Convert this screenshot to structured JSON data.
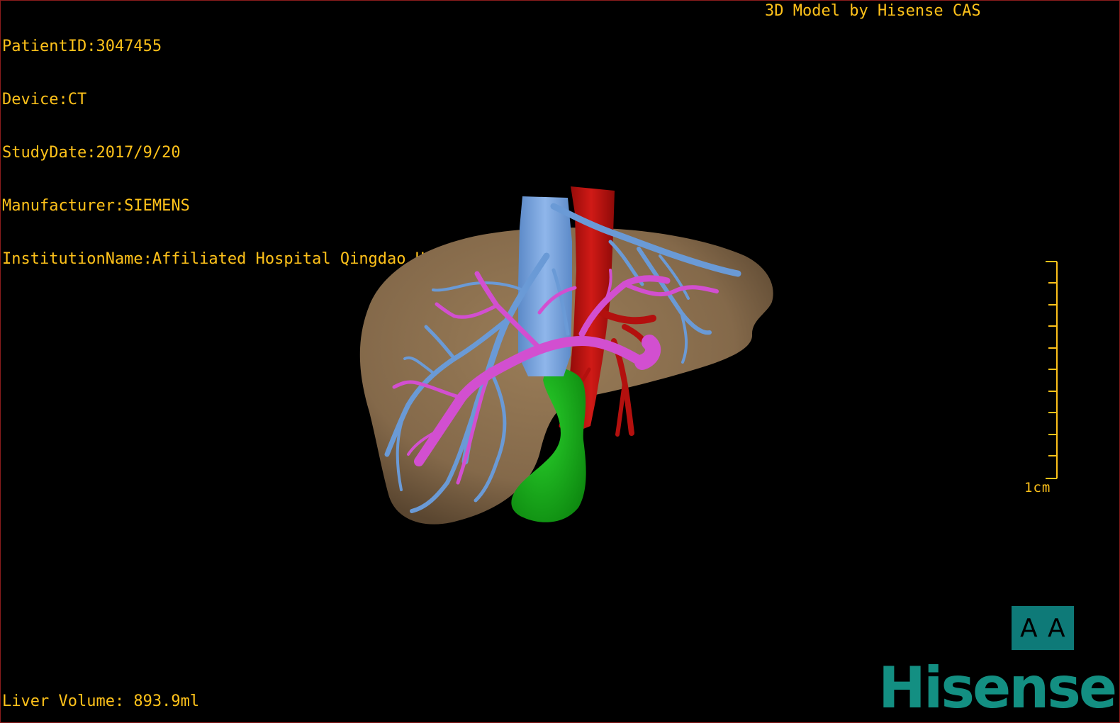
{
  "header": {
    "patient_id": "PatientID:3047455",
    "device": "Device:CT",
    "study_date": "StudyDate:2017/9/20",
    "manufacturer": "Manufacturer:SIEMENS",
    "institution": "InstitutionName:Affiliated Hospital Qingdao University-C"
  },
  "credit": "3D Model by Hisense CAS",
  "footer": {
    "liver_volume": "Liver Volume: 893.9ml"
  },
  "scale": {
    "label": "1cm",
    "color": "#ffc21a"
  },
  "orientation": {
    "left_glyph": "A",
    "right_glyph": "A"
  },
  "brand": {
    "name": "Hisense",
    "color": "#138f82"
  },
  "colors": {
    "liver": "#8a6e4b",
    "hepatic_vein": "#6a9ad6",
    "portal_vein": "#d24fd0",
    "artery": "#b3100e",
    "gallbladder": "#16a418",
    "text": "#ffc21a",
    "frame": "#8b1c1c"
  }
}
